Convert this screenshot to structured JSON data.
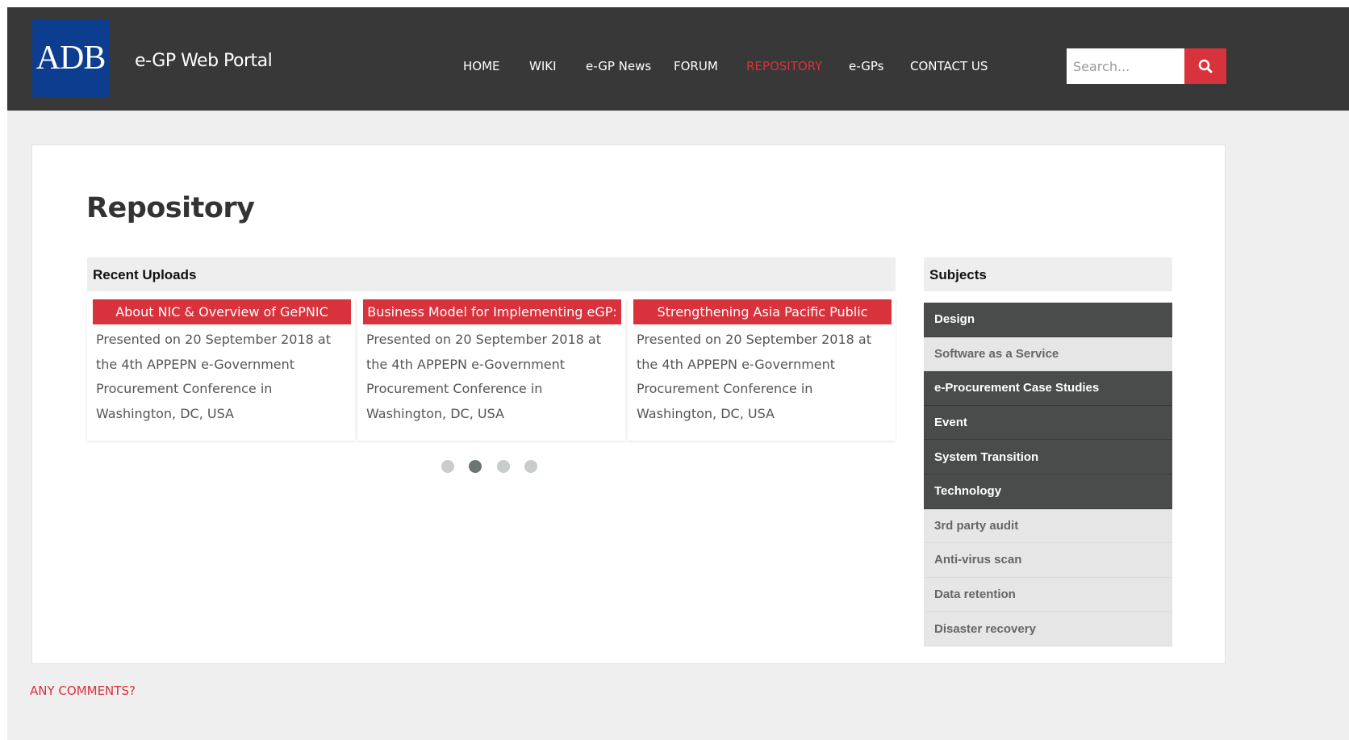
{
  "header": {
    "logo_text": "ADB",
    "site_title": "e-GP Web Portal",
    "nav": [
      {
        "label": "HOME",
        "active": false
      },
      {
        "label": "WIKI",
        "active": false
      },
      {
        "label": "e-GP News",
        "active": false
      },
      {
        "label": "FORUM",
        "active": false
      },
      {
        "label": "REPOSITORY",
        "active": true
      },
      {
        "label": "e-GPs",
        "active": false
      },
      {
        "label": "CONTACT US",
        "active": false
      }
    ],
    "search": {
      "placeholder": "Search...",
      "value": "",
      "button_icon": "search-icon"
    }
  },
  "main": {
    "page_title": "Repository",
    "recent_uploads": {
      "heading": "Recent Uploads",
      "items": [
        {
          "title": "About NIC & Overview of GePNIC",
          "description": "Presented on 20 September 2018 at the 4th APPEPN e-Government Procurement Conference in Washington, DC, USA"
        },
        {
          "title": "Business Model for Implementing eGP:",
          "description": "Presented on 20 September 2018 at the 4th APPEPN e-Government Procurement Conference in Washington, DC, USA"
        },
        {
          "title": "Strengthening Asia Pacific Public",
          "description": "Presented on 20 September 2018 at the 4th APPEPN e-Government Procurement Conference in Washington, DC, USA"
        }
      ],
      "carousel": {
        "pages": 4,
        "active_index": 1
      }
    },
    "subjects": {
      "heading": "Subjects",
      "items": [
        {
          "label": "Design",
          "style": "dark"
        },
        {
          "label": "Software as a Service",
          "style": "light"
        },
        {
          "label": "e-Procurement Case Studies",
          "style": "dark"
        },
        {
          "label": "Event",
          "style": "dark"
        },
        {
          "label": "System Transition",
          "style": "dark"
        },
        {
          "label": "Technology",
          "style": "dark"
        },
        {
          "label": "3rd party audit",
          "style": "light"
        },
        {
          "label": "Anti-virus scan",
          "style": "light"
        },
        {
          "label": "Data retention",
          "style": "light"
        },
        {
          "label": "Disaster recovery",
          "style": "light"
        }
      ]
    }
  },
  "footer": {
    "comments_heading": "ANY COMMENTS?"
  },
  "colors": {
    "accent": "#d8323c",
    "header_bg": "#383838",
    "logo_bg": "#0d3d8f",
    "subject_dark": "#4a4c4c",
    "subject_light": "#e6e6e6"
  }
}
